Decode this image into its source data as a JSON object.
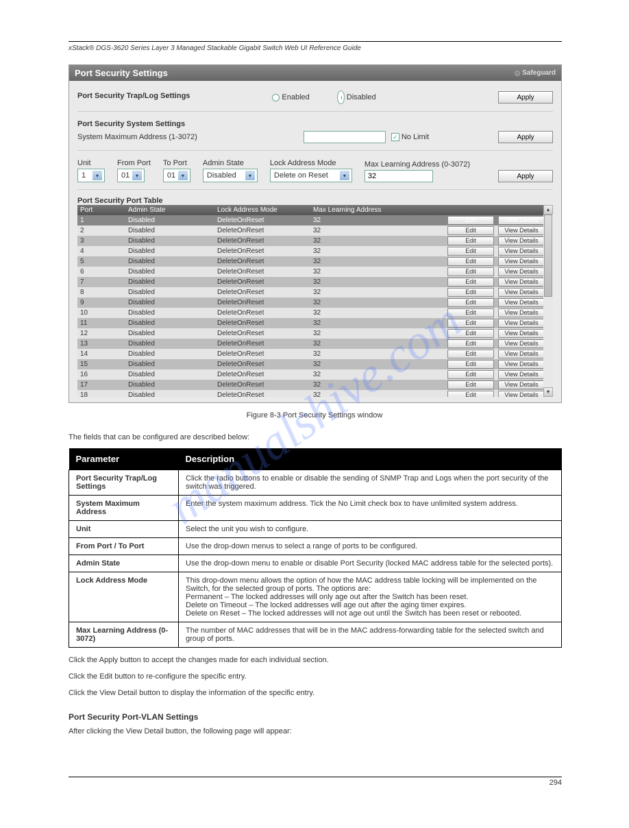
{
  "page_header": "xStack® DGS-3620 Series Layer 3 Managed Stackable Gigabit Switch Web UI Reference Guide",
  "panel_title": "Port Security Settings",
  "safeguard_label": "Safeguard",
  "traplog": {
    "title": "Port Security Trap/Log Settings",
    "enabled": "Enabled",
    "disabled": "Disabled",
    "selected": "disabled"
  },
  "system": {
    "title": "Port Security System Settings",
    "label": "System Maximum Address (1-3072)",
    "nolimit": "No Limit",
    "nolimit_checked": true
  },
  "controls": {
    "unit_label": "Unit",
    "unit_value": "1",
    "from_label": "From Port",
    "from_value": "01",
    "to_label": "To Port",
    "to_value": "01",
    "admin_label": "Admin State",
    "admin_value": "Disabled",
    "lock_label": "Lock Address Mode",
    "lock_value": "Delete on Reset",
    "max_label": "Max Learning Address (0-3072)",
    "max_value": "32"
  },
  "apply_label": "Apply",
  "port_table": {
    "title": "Port Security Port Table",
    "h_port": "Port",
    "h_admin": "Admin State",
    "h_lock": "Lock Address Mode",
    "h_max": "Max Learning Address",
    "edit": "Edit",
    "view": "View Details",
    "rows": [
      {
        "port": "1",
        "admin": "Disabled",
        "lock": "DeleteOnReset",
        "max": "32"
      },
      {
        "port": "2",
        "admin": "Disabled",
        "lock": "DeleteOnReset",
        "max": "32"
      },
      {
        "port": "3",
        "admin": "Disabled",
        "lock": "DeleteOnReset",
        "max": "32"
      },
      {
        "port": "4",
        "admin": "Disabled",
        "lock": "DeleteOnReset",
        "max": "32"
      },
      {
        "port": "5",
        "admin": "Disabled",
        "lock": "DeleteOnReset",
        "max": "32"
      },
      {
        "port": "6",
        "admin": "Disabled",
        "lock": "DeleteOnReset",
        "max": "32"
      },
      {
        "port": "7",
        "admin": "Disabled",
        "lock": "DeleteOnReset",
        "max": "32"
      },
      {
        "port": "8",
        "admin": "Disabled",
        "lock": "DeleteOnReset",
        "max": "32"
      },
      {
        "port": "9",
        "admin": "Disabled",
        "lock": "DeleteOnReset",
        "max": "32"
      },
      {
        "port": "10",
        "admin": "Disabled",
        "lock": "DeleteOnReset",
        "max": "32"
      },
      {
        "port": "11",
        "admin": "Disabled",
        "lock": "DeleteOnReset",
        "max": "32"
      },
      {
        "port": "12",
        "admin": "Disabled",
        "lock": "DeleteOnReset",
        "max": "32"
      },
      {
        "port": "13",
        "admin": "Disabled",
        "lock": "DeleteOnReset",
        "max": "32"
      },
      {
        "port": "14",
        "admin": "Disabled",
        "lock": "DeleteOnReset",
        "max": "32"
      },
      {
        "port": "15",
        "admin": "Disabled",
        "lock": "DeleteOnReset",
        "max": "32"
      },
      {
        "port": "16",
        "admin": "Disabled",
        "lock": "DeleteOnReset",
        "max": "32"
      },
      {
        "port": "17",
        "admin": "Disabled",
        "lock": "DeleteOnReset",
        "max": "32"
      },
      {
        "port": "18",
        "admin": "Disabled",
        "lock": "DeleteOnReset",
        "max": "32"
      }
    ]
  },
  "caption": "Figure 8-3 Port Security Settings window",
  "para_intro": "The fields that can be configured are described below:",
  "fields_table": {
    "h1": "Parameter",
    "h2": "Description",
    "rows": [
      {
        "p": "Port Security Trap/Log Settings",
        "d": "Click the radio buttons to enable or disable the sending of SNMP Trap and Logs when the port security of the switch was triggered."
      },
      {
        "p": "System Maximum Address",
        "d": "Enter the system maximum address. Tick the No Limit check box to have unlimited system address."
      },
      {
        "p": "Unit",
        "d": "Select the unit you wish to configure."
      },
      {
        "p": "From Port / To Port",
        "d": "Use the drop-down menus to select a range of ports to be configured."
      },
      {
        "p": "Admin State",
        "d": "Use the drop-down menu to enable or disable Port Security (locked MAC address table for the selected ports)."
      },
      {
        "p": "Lock Address Mode",
        "d": "This drop-down menu allows the option of how the MAC address table locking will be implemented on the Switch, for the selected group of ports. The options are:\nPermanent – The locked addresses will only age out after the Switch has been reset.\nDelete on Timeout – The locked addresses will age out after the aging timer expires.\nDelete on Reset – The locked addresses will not age out until the Switch has been reset or rebooted."
      },
      {
        "p": "Max Learning Address (0-3072)",
        "d": "The number of MAC addresses that will be in the MAC address-forwarding table for the selected switch and group of ports."
      }
    ]
  },
  "click_apply": "Click the Apply button to accept the changes made for each individual section.",
  "click_edit": "Click the Edit button to re-configure the specific entry.",
  "click_view": "Click the View Detail button to display the information of the specific entry.",
  "detail_heading": "Port Security Port-VLAN Settings",
  "detail_para": "After clicking the View Detail button, the following page will appear:",
  "page_number": "294",
  "watermark": "manualshive.com"
}
